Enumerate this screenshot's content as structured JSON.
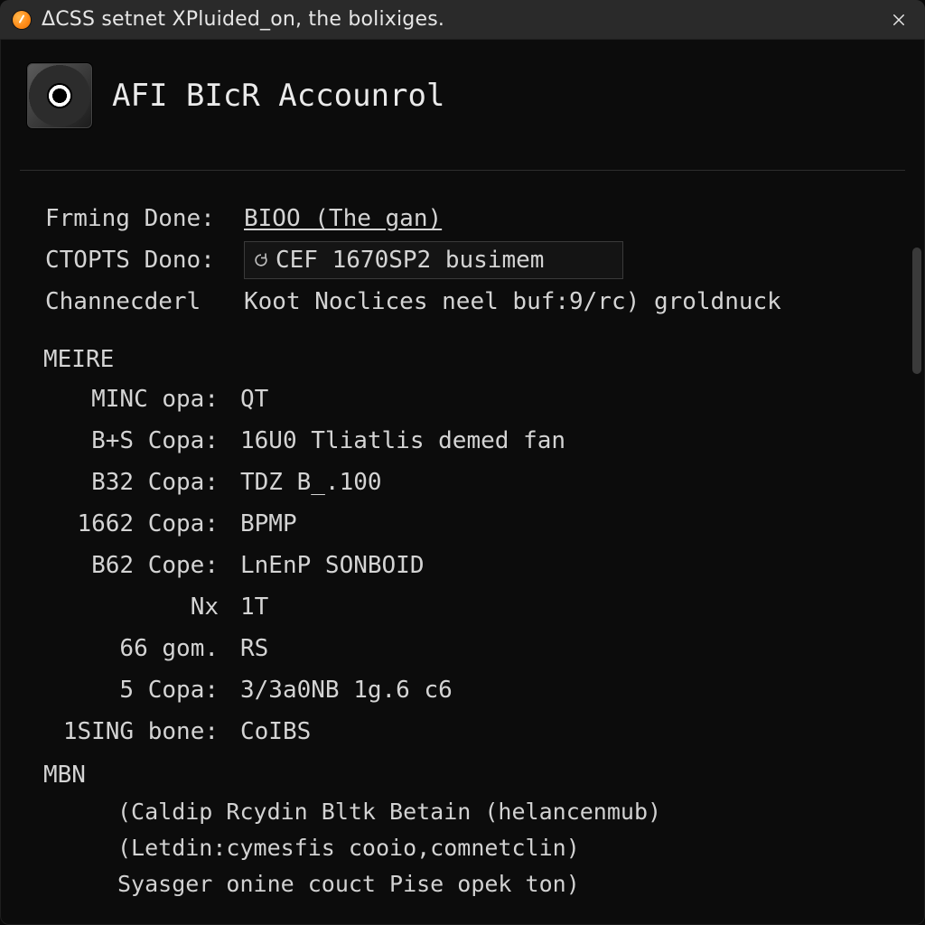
{
  "window": {
    "title": "ΔCSS setnet XPluided_on, the bolixiges."
  },
  "header": {
    "title": "AFI BIcR Accounrol"
  },
  "top_fields": {
    "frming_label": "Frming Done:",
    "frming_value": "BIOO (The gan)",
    "ctopts_label": "CTOPTS Dono:",
    "ctopts_value": "CEF 1670SP2 busimem",
    "chann_label": "Channecderl",
    "chann_value": "Koot Noclices neel buf:9/rc) groldnuck"
  },
  "sections": {
    "meire_title": "MEIRE",
    "meire_rows": [
      {
        "label": "MINC opa:",
        "value": "QT"
      },
      {
        "label": "B+S Copa:",
        "value": "16U0 Tliatlis demed fan"
      },
      {
        "label": "B32 Copa:",
        "value": "TDZ B_.100"
      },
      {
        "label": "1662 Copa:",
        "value": "BPMP"
      },
      {
        "label": "B62 Cope:",
        "value": "LnEnP SONBOID"
      },
      {
        "label": "Nx",
        "value": "1T"
      },
      {
        "label": "66 gom.",
        "value": "RS"
      },
      {
        "label": "5  Copa:",
        "value": "3/3a0NB 1g.6 c6"
      },
      {
        "label": "1SING bone:",
        "value": "CoIBS"
      }
    ],
    "mbn_title": "MBN",
    "mbn_lines": [
      "(Caldip Rcydin Bltk Betain (helancenmub)",
      "(Letdin:cymesfis cooio,comnetclin)",
      "Syasger onine couct Pise opek ton)"
    ]
  }
}
